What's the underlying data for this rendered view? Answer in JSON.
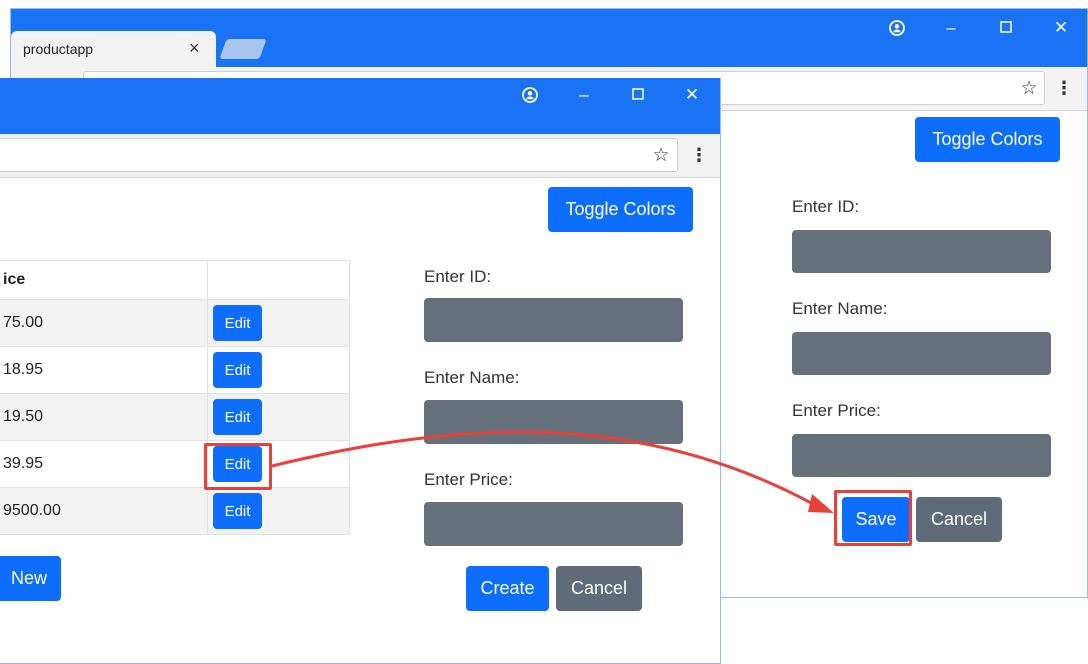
{
  "back_window": {
    "tab_title": "productapp",
    "toggle_colors": "Toggle Colors",
    "labels": {
      "id": "Enter ID:",
      "name": "Enter Name:",
      "price": "Enter Price:"
    },
    "save": "Save",
    "cancel": "Cancel"
  },
  "front_window": {
    "toggle_colors": "Toggle Colors",
    "table": {
      "header": "ice",
      "rows": [
        {
          "price": "75.00",
          "action": "Edit"
        },
        {
          "price": "18.95",
          "action": "Edit"
        },
        {
          "price": "19.50",
          "action": "Edit"
        },
        {
          "price": "39.95",
          "action": "Edit"
        },
        {
          "price": "9500.00",
          "action": "Edit"
        }
      ]
    },
    "new_button": "New",
    "labels": {
      "id": "Enter ID:",
      "name": "Enter Name:",
      "price": "Enter Price:"
    },
    "create": "Create",
    "cancel": "Cancel"
  },
  "colors": {
    "titlebar": "#1a73f5",
    "primary": "#0d6efd",
    "secondary": "#5f6b78",
    "highlight": "#e8403a"
  },
  "icons": [
    "account-icon",
    "minimize-icon",
    "maximize-icon",
    "close-icon",
    "star-icon",
    "menu-dots-icon",
    "tab-close-icon"
  ]
}
